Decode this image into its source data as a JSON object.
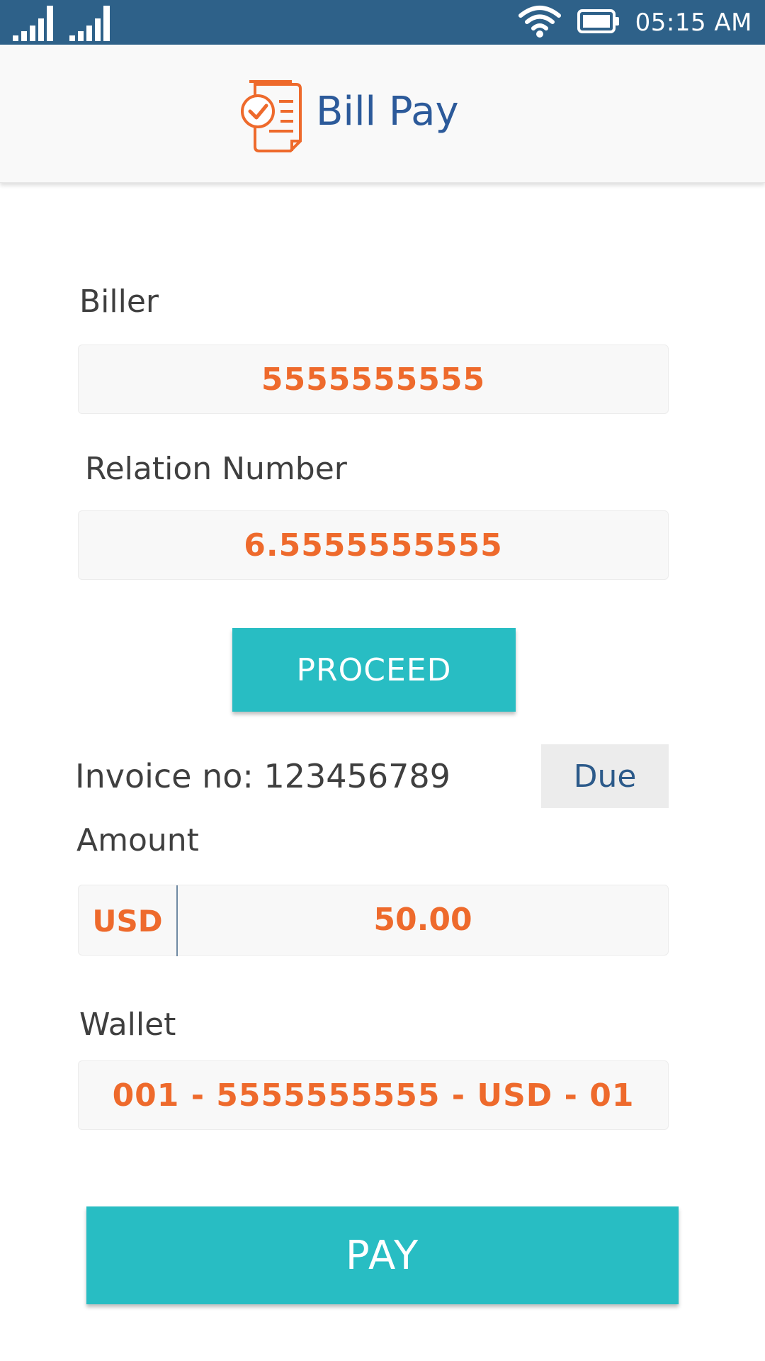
{
  "status_bar": {
    "time": "05:15 AM",
    "icons": [
      "signal-icon",
      "signal-icon",
      "wifi-icon",
      "battery-icon"
    ],
    "color": "#2e6189"
  },
  "header": {
    "title": "Bill Pay",
    "icon": "bill-document-check-icon",
    "title_color": "#2c5a9a",
    "icon_color": "#ee6a2c"
  },
  "form": {
    "biller_label": "Biller",
    "biller_value": "5555555555",
    "relation_label": "Relation Number",
    "relation_value": "6.5555555555",
    "proceed_label": "PROCEED",
    "invoice_text": "Invoice no: 123456789",
    "due_label": "Due",
    "amount_label": "Amount",
    "currency": "USD",
    "amount_value": "50.00",
    "wallet_label": "Wallet",
    "wallet_value": "001 - 5555555555 - USD - 01",
    "pay_label": "PAY"
  },
  "colors": {
    "accent": "#28bdc3",
    "value_text": "#ee6a2c",
    "label_text": "#3f3f3f"
  }
}
